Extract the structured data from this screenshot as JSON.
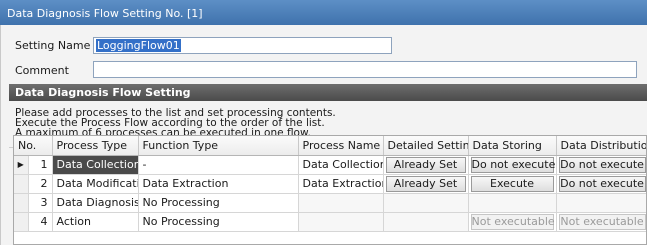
{
  "window": {
    "title": "Data Diagnosis Flow Setting No. [1]"
  },
  "form": {
    "setting_name_label": "Setting Name",
    "setting_name_value": "LoggingFlow01",
    "comment_label": "Comment",
    "comment_value": ""
  },
  "section": {
    "title": "Data Diagnosis Flow Setting",
    "description": [
      "Please add processes to the list and set processing contents.",
      "Execute the Process Flow according to the order of the list.",
      "A maximum of 6 processes can be executed in one flow."
    ]
  },
  "table": {
    "columns": [
      "No.",
      "Process Type",
      "Function Type",
      "Process Name",
      "Detailed Setting",
      "Data Storing",
      "Data Distribution"
    ],
    "rows": [
      {
        "marker": "▶",
        "no": "1",
        "process_type": "Data Collection",
        "function_type": "-",
        "process_name": "Data Collection",
        "detailed_setting": "Already Set",
        "data_storing": "Do not execute",
        "data_distribution": "Do not execute"
      },
      {
        "marker": "",
        "no": "2",
        "process_type": "Data Modification",
        "function_type": "Data Extraction",
        "process_name": "Data Extraction",
        "detailed_setting": "Already Set",
        "data_storing": "Execute",
        "data_distribution": "Do not execute"
      },
      {
        "marker": "",
        "no": "3",
        "process_type": "Data Diagnosis",
        "function_type": "No Processing",
        "process_name": "",
        "detailed_setting": "",
        "data_storing": "",
        "data_distribution": ""
      },
      {
        "marker": "",
        "no": "4",
        "process_type": "Action",
        "function_type": "No Processing",
        "process_name": "",
        "detailed_setting": "",
        "data_storing": "Not executable",
        "data_distribution": "Not executable"
      }
    ]
  }
}
